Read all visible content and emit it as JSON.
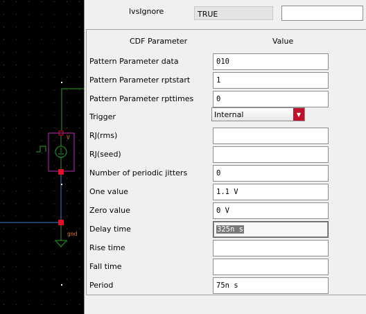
{
  "top": {
    "label": "lvsIgnore",
    "value": "TRUE",
    "input": ""
  },
  "table": {
    "header_param": "CDF Parameter",
    "header_value": "Value",
    "rows": [
      {
        "label": "Pattern Parameter data",
        "value": "010"
      },
      {
        "label": "Pattern Parameter rptstart",
        "value": "1"
      },
      {
        "label": "Pattern Parameter rpttimes",
        "value": "0"
      },
      {
        "label": "Trigger",
        "value": "Internal"
      },
      {
        "label": "RJ(rms)",
        "value": ""
      },
      {
        "label": "RJ(seed)",
        "value": ""
      },
      {
        "label": "Number of periodic jitters",
        "value": "0"
      },
      {
        "label": "One value",
        "value": "1.1 V"
      },
      {
        "label": "Zero value",
        "value": "0 V"
      },
      {
        "label": "Delay time",
        "value": "325n s"
      },
      {
        "label": "Rise time",
        "value": ""
      },
      {
        "label": "Fall time",
        "value": ""
      },
      {
        "label": "Period",
        "value": "75n s"
      }
    ]
  },
  "schematic": {
    "source_label": "V",
    "ground_label": "gnd"
  },
  "colors": {
    "wire": "#3d7fd6",
    "green_wire": "#2aa02a",
    "component": "#c02ac0",
    "pin": "#e0102a",
    "label": "#e07a20",
    "combo_button": "#c0102a"
  }
}
